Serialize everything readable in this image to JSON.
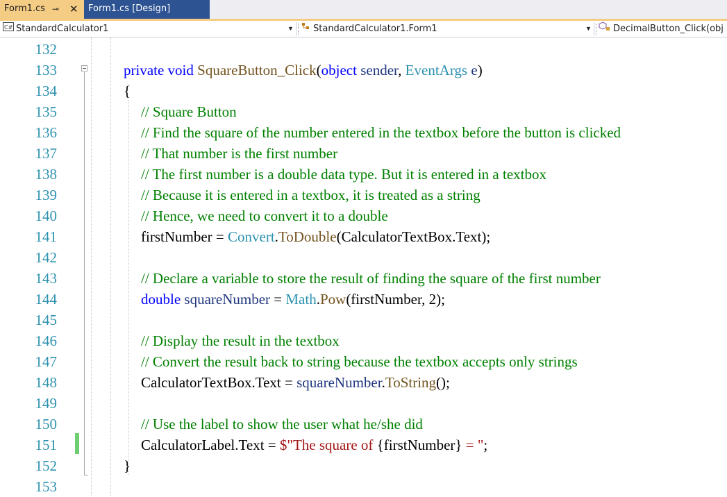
{
  "tabs": [
    {
      "label": "Form1.cs",
      "active": true,
      "pin_icon": "pin-icon",
      "close_icon": "close-icon"
    },
    {
      "label": "Form1.cs [Design]",
      "active": false
    }
  ],
  "navbar": {
    "project": "StandardCalculator1",
    "type": "StandardCalculator1.Form1",
    "member": "DecimalButton_Click(obj"
  },
  "colors": {
    "active_tab": "#f5cc84",
    "inactive_tab": "#2d5392",
    "line_number": "#2b91af",
    "keyword": "#0000ff",
    "type": "#2b91af",
    "method": "#74531f",
    "comment": "#008000",
    "string": "#a31515",
    "variable": "#1f377f",
    "change_bar": "#6ece71"
  },
  "editor": {
    "lines": [
      {
        "n": "132",
        "tokens": []
      },
      {
        "n": "133",
        "tokens": [
          [
            "kw",
            "private void "
          ],
          [
            "mt",
            "SquareButton_Click"
          ],
          [
            "",
            "("
          ],
          [
            "kw",
            "object "
          ],
          [
            "vr",
            "sender"
          ],
          [
            "",
            ", "
          ],
          [
            "ty",
            "EventArgs "
          ],
          [
            "vr",
            "e"
          ],
          [
            "",
            ")"
          ]
        ]
      },
      {
        "n": "134",
        "tokens": [
          [
            "",
            "{"
          ]
        ]
      },
      {
        "n": "135",
        "tokens": [
          [
            "cm",
            "// Square Button"
          ]
        ]
      },
      {
        "n": "136",
        "tokens": [
          [
            "cm",
            "// Find the square of the number entered in the textbox before the button is clicked"
          ]
        ]
      },
      {
        "n": "137",
        "tokens": [
          [
            "cm",
            "// That number is the first number"
          ]
        ]
      },
      {
        "n": "138",
        "tokens": [
          [
            "cm",
            "// The first number is a double data type. But it is entered in a textbox"
          ]
        ]
      },
      {
        "n": "139",
        "tokens": [
          [
            "cm",
            "// Because it is entered in a textbox, it is treated as a string"
          ]
        ]
      },
      {
        "n": "140",
        "tokens": [
          [
            "cm",
            "// Hence, we need to convert it to a double"
          ]
        ]
      },
      {
        "n": "141",
        "tokens": [
          [
            "",
            "firstNumber = "
          ],
          [
            "ty",
            "Convert"
          ],
          [
            "",
            "."
          ],
          [
            "mt",
            "ToDouble"
          ],
          [
            "",
            "(CalculatorTextBox.Text);"
          ]
        ]
      },
      {
        "n": "142",
        "tokens": []
      },
      {
        "n": "143",
        "tokens": [
          [
            "cm",
            "// Declare a variable to store the result of finding the square of the first number"
          ]
        ]
      },
      {
        "n": "144",
        "tokens": [
          [
            "kw",
            "double "
          ],
          [
            "vr",
            "squareNumber"
          ],
          [
            "",
            " = "
          ],
          [
            "ty",
            "Math"
          ],
          [
            "",
            "."
          ],
          [
            "mt",
            "Pow"
          ],
          [
            "",
            "(firstNumber, 2);"
          ]
        ]
      },
      {
        "n": "145",
        "tokens": []
      },
      {
        "n": "146",
        "tokens": [
          [
            "cm",
            "// Display the result in the textbox"
          ]
        ]
      },
      {
        "n": "147",
        "tokens": [
          [
            "cm",
            "// Convert the result back to string because the textbox accepts only strings"
          ]
        ]
      },
      {
        "n": "148",
        "tokens": [
          [
            "",
            "CalculatorTextBox.Text = "
          ],
          [
            "vr",
            "squareNumber"
          ],
          [
            "",
            "."
          ],
          [
            "mt",
            "ToString"
          ],
          [
            "",
            "();"
          ]
        ]
      },
      {
        "n": "149",
        "tokens": []
      },
      {
        "n": "150",
        "tokens": [
          [
            "cm",
            "// Use the label to show the user what he/she did"
          ]
        ]
      },
      {
        "n": "151",
        "tokens": [
          [
            "",
            "CalculatorLabel.Text = "
          ],
          [
            "st",
            "$\"The square of "
          ],
          [
            "",
            "{firstNumber}"
          ],
          [
            "st",
            " = \""
          ],
          [
            "",
            ";"
          ]
        ]
      },
      {
        "n": "152",
        "tokens": [
          [
            "",
            "}"
          ]
        ]
      },
      {
        "n": "153",
        "tokens": []
      }
    ]
  }
}
